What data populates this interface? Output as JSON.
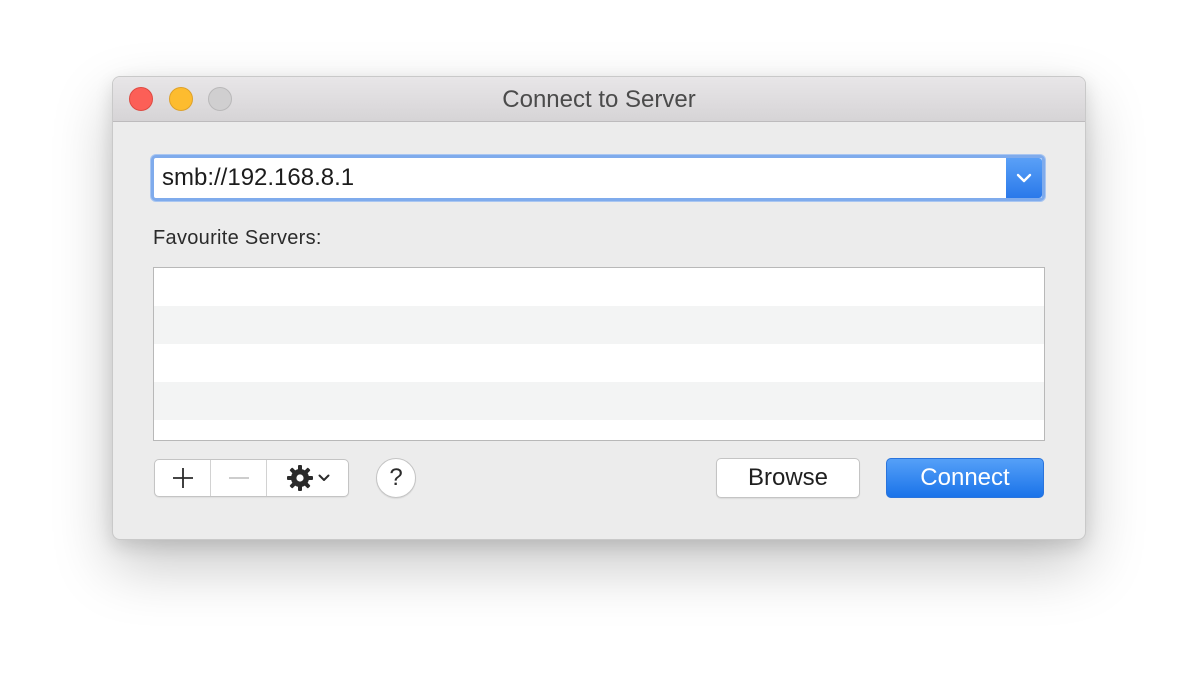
{
  "window": {
    "title": "Connect to Server"
  },
  "server_address": {
    "value": "smb://192.168.8.1"
  },
  "favourites": {
    "label": "Favourite Servers:",
    "rows": [
      "",
      "",
      "",
      "",
      ""
    ]
  },
  "toolbar": {
    "add_symbol": "+",
    "remove_symbol": "—",
    "help_label": "?"
  },
  "actions": {
    "browse_label": "Browse",
    "connect_label": "Connect"
  },
  "colors": {
    "accent": "#2a79ea",
    "close": "#fc5f57",
    "minimize": "#fdbc2f",
    "zoom_disabled": "#d0cfd0"
  },
  "icons": {
    "dropdown": "chevron-down-icon",
    "add": "plus-icon",
    "remove": "minus-icon",
    "action": "gear-icon",
    "help": "help-icon"
  }
}
